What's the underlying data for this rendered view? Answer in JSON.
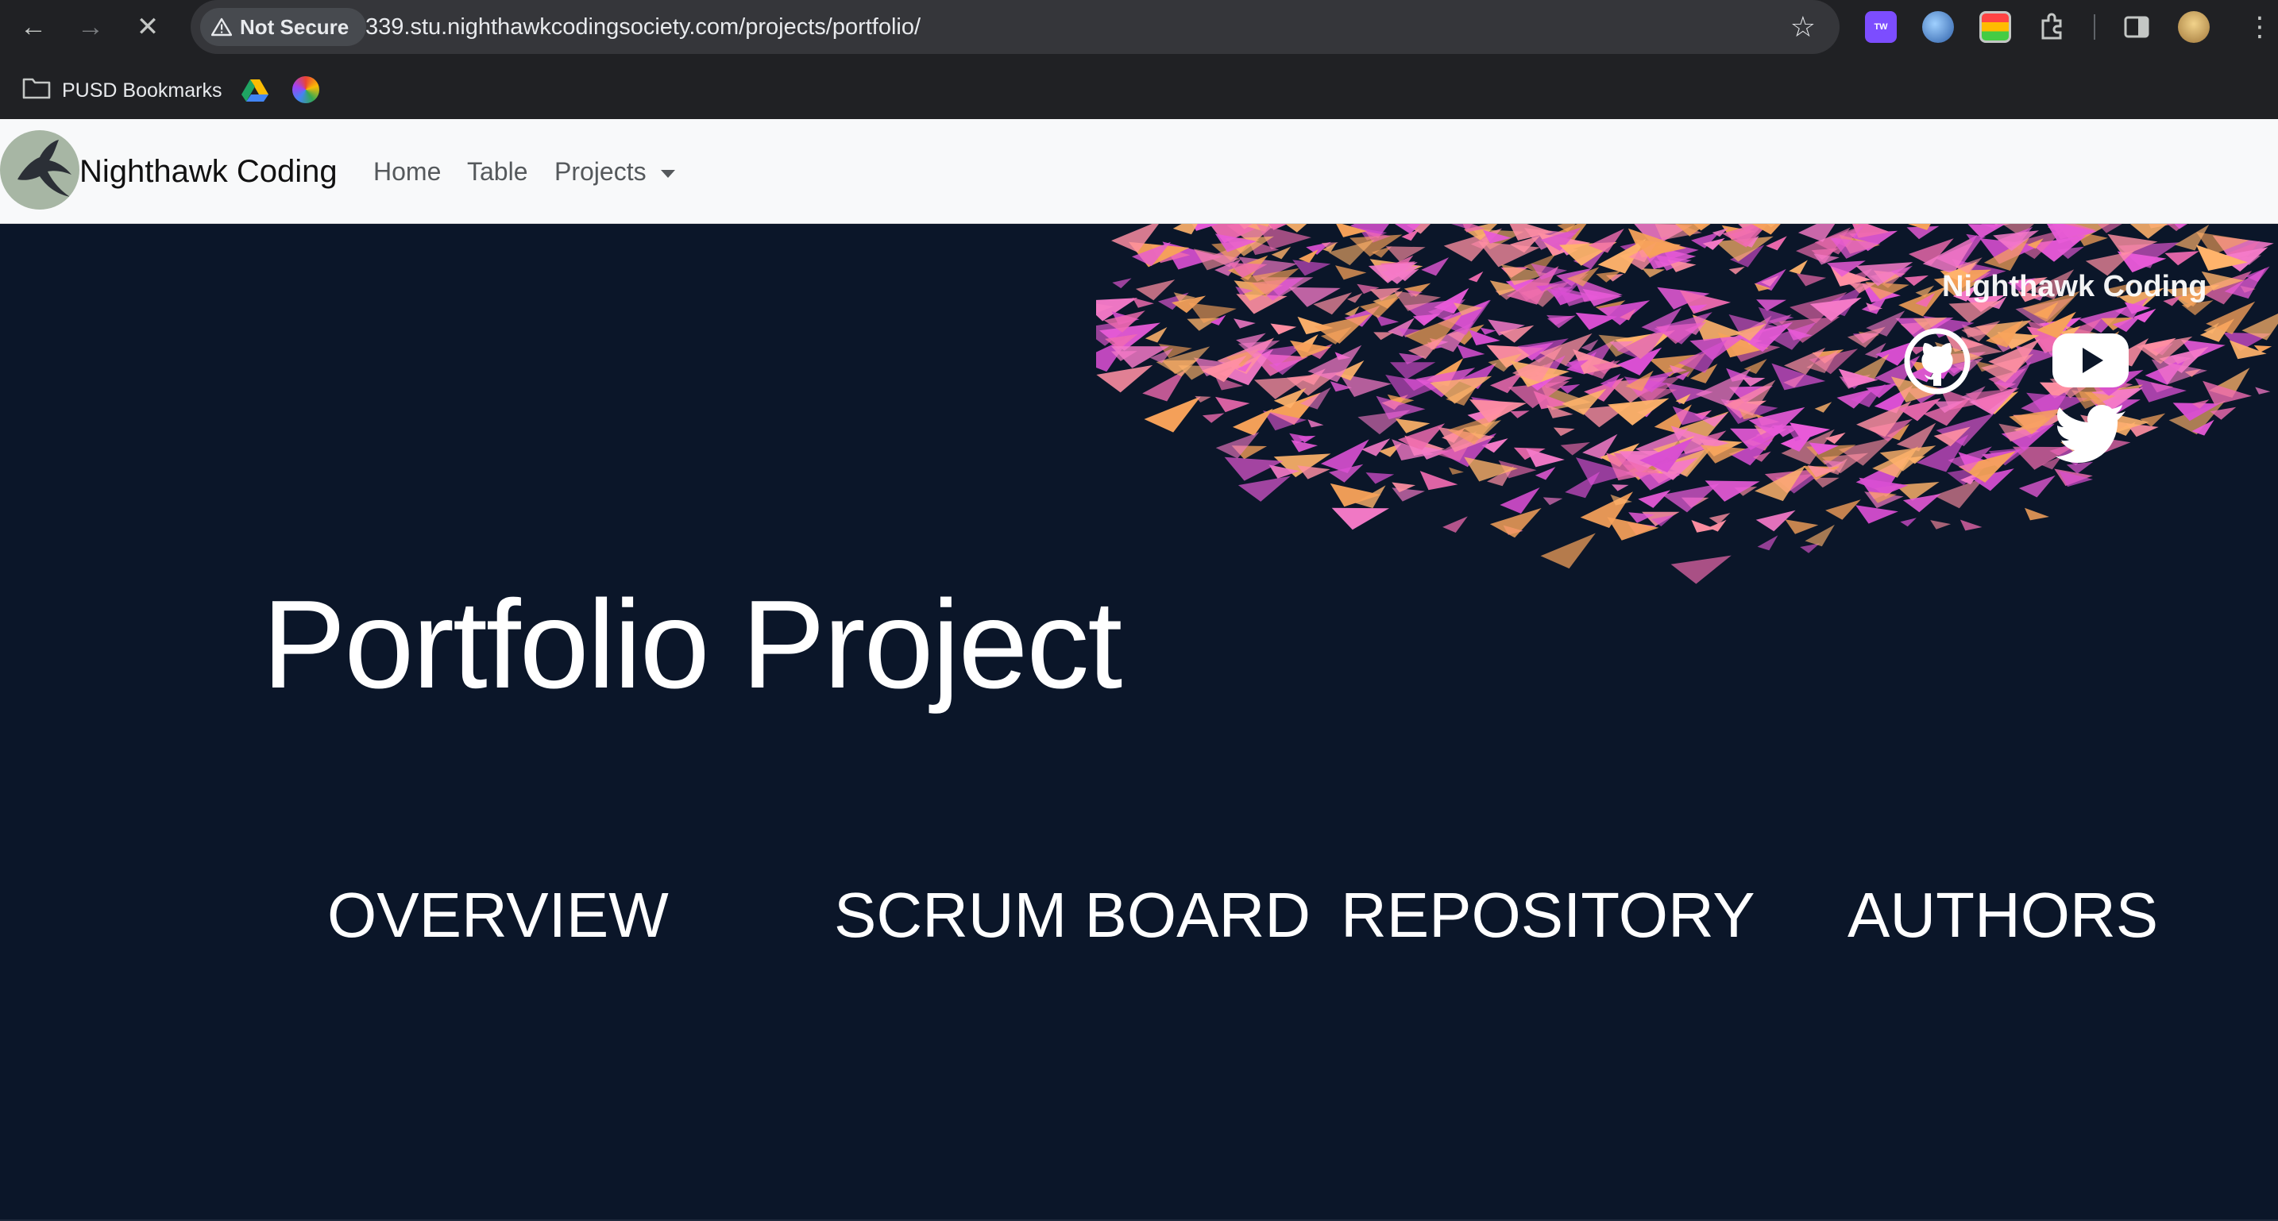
{
  "browser": {
    "security_label": "Not Secure",
    "url": "339.stu.nighthawkcodingsociety.com/projects/portfolio/",
    "bookmarks": [
      {
        "label": "PUSD Bookmarks",
        "icon": "folder-icon"
      },
      {
        "label": "",
        "icon": "google-drive-icon"
      },
      {
        "label": "",
        "icon": "colorful-app-icon"
      }
    ],
    "extension_badge": "TW"
  },
  "nav": {
    "brand": "Nighthawk Coding",
    "links": [
      "Home",
      "Table",
      "Projects"
    ]
  },
  "hero": {
    "footer_title": "Nighthawk Coding",
    "social_icons": [
      "github-icon",
      "youtube-icon",
      "twitter-icon"
    ],
    "title": "Portfolio Project",
    "sections": [
      "OVERVIEW",
      "SCRUM BOARD",
      "REPOSITORY",
      "AUTHORS"
    ]
  },
  "colors": {
    "hero_bg": "#0b1629",
    "nav_bg": "#f8f9fa",
    "chrome_bg": "#202124",
    "flock_pink": "#e85ad8",
    "flock_orange": "#f7a25a"
  }
}
